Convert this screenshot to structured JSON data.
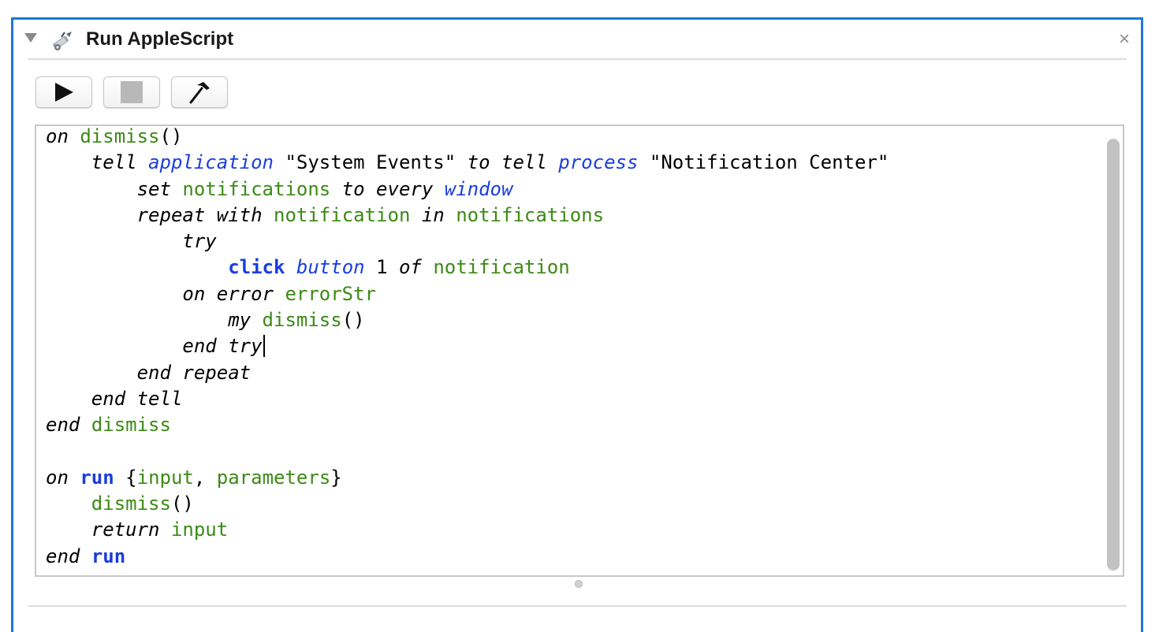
{
  "header": {
    "title": "Run AppleScript",
    "close_glyph": "×",
    "disclosure_icon": "triangle-down-icon",
    "action_icon": "applescript-icon"
  },
  "toolbar": {
    "run_icon": "play-icon",
    "stop_icon": "stop-icon",
    "compile_icon": "hammer-icon"
  },
  "editor": {
    "lines": [
      "on dismiss()",
      "    tell application \"System Events\" to tell process \"Notification Center\"",
      "        set notifications to every window",
      "        repeat with notification in notifications",
      "            try",
      "                click button 1 of notification",
      "            on error errorStr",
      "                my dismiss()",
      "            end try",
      "        end repeat",
      "    end tell",
      "end dismiss",
      "",
      "on run {input, parameters}",
      "    dismiss()",
      "    return input",
      "end run"
    ],
    "colors": {
      "keyword": "#000000",
      "application_term": "#1a3de0",
      "variable": "#3c8a16",
      "command": "#1a3de0"
    }
  },
  "accent_color": "#1d78d6"
}
